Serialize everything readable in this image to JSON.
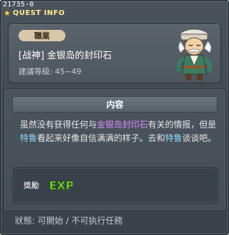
{
  "window": {
    "quest_id": "21735-0",
    "title": "QUEST INFO"
  },
  "quest": {
    "job_badge": "職業",
    "name": "[战神] 金银岛的封印石",
    "level": "建議等級: 45~49"
  },
  "content": {
    "header": "内容",
    "segments": [
      {
        "text": "虽然没有获得任何与",
        "style": "normal"
      },
      {
        "text": "金银岛封印石",
        "style": "purple"
      },
      {
        "text": "有关的情报，但是",
        "style": "normal"
      },
      {
        "text": "特鲁",
        "style": "cyan"
      },
      {
        "text": "看起来好像自信满满的样子。去和",
        "style": "normal"
      },
      {
        "text": "特鲁",
        "style": "cyan"
      },
      {
        "text": "谈谈吧。",
        "style": "normal"
      }
    ]
  },
  "reward": {
    "label": "獎勵",
    "exp_icon_text": "EXP"
  },
  "status": {
    "text": "狀態: 可開始 / 不可执行任務"
  },
  "colors": {
    "highlight_item": "#d78cff",
    "highlight_npc": "#8cd8ff",
    "title_text": "#ffe890",
    "exp_icon": "#7be03a"
  },
  "icons": {
    "title_star": "star-icon",
    "npc": "npc-portrait",
    "reward": "exp-icon"
  }
}
